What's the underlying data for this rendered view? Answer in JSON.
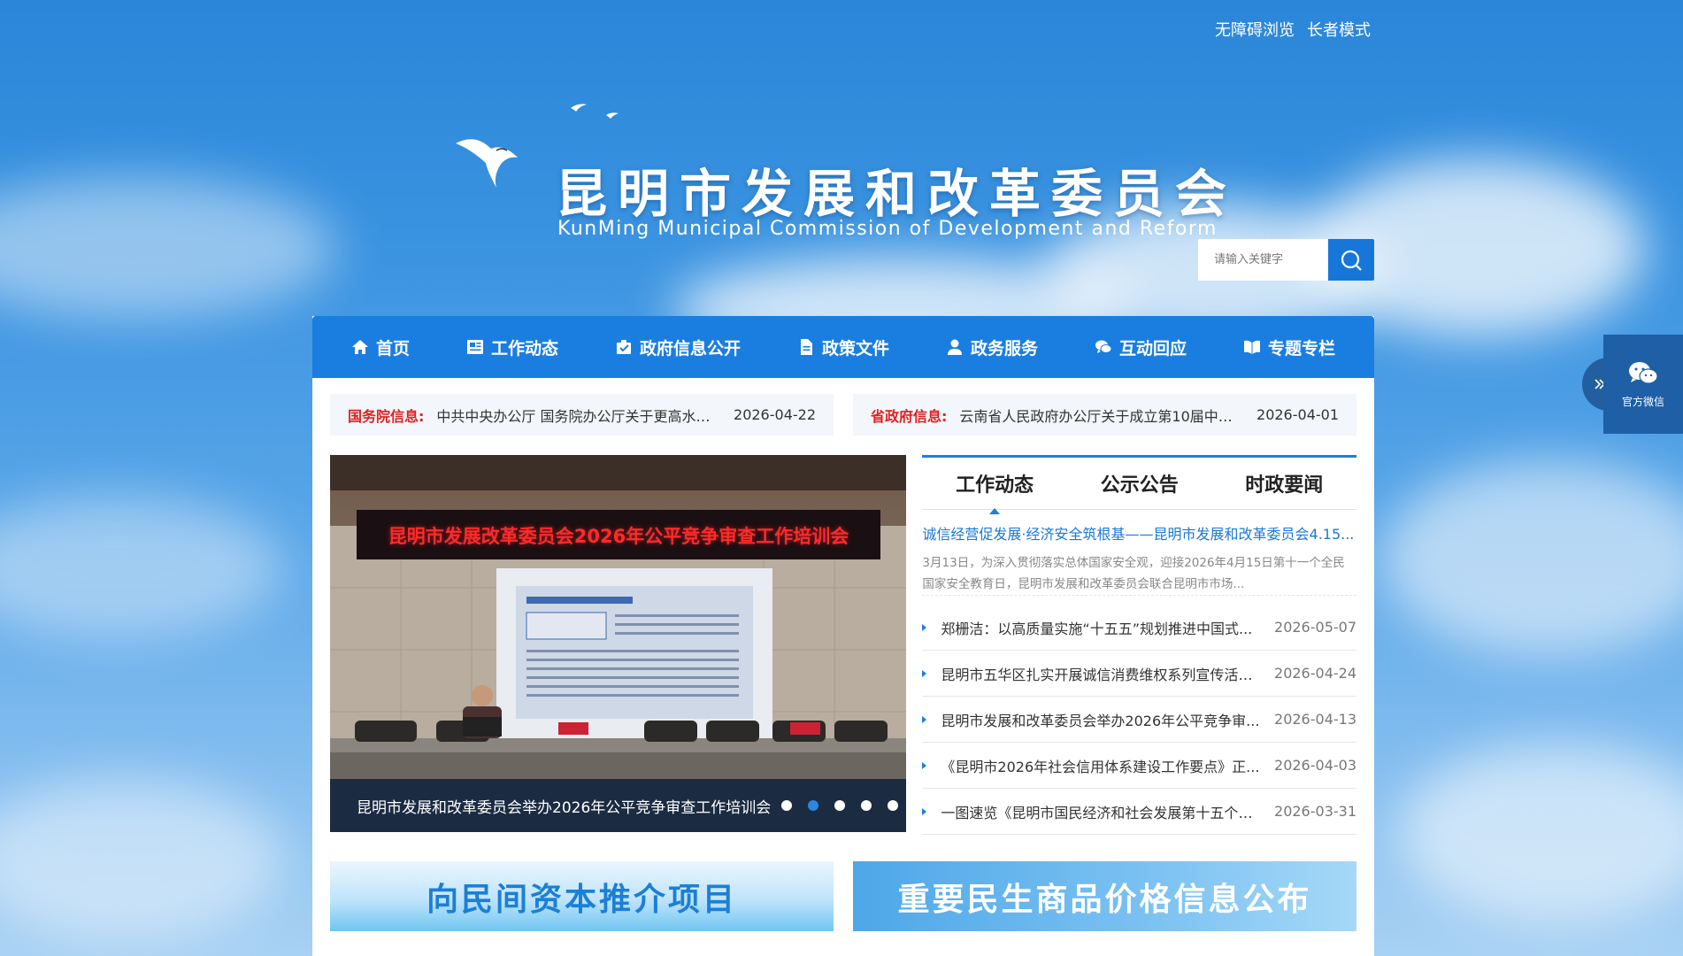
{
  "topbar": {
    "accessible": "无障碍浏览",
    "elder_mode": "长者模式"
  },
  "header": {
    "title": "昆明市发展和改革委员会",
    "subtitle": "KunMing Municipal Commission of Development and Reform"
  },
  "search": {
    "placeholder": "请输入关键字"
  },
  "nav": [
    {
      "label": "首页",
      "icon": "home-icon"
    },
    {
      "label": "工作动态",
      "icon": "news-icon"
    },
    {
      "label": "政府信息公开",
      "icon": "clipboard-icon"
    },
    {
      "label": "政策文件",
      "icon": "document-icon"
    },
    {
      "label": "政务服务",
      "icon": "user-icon"
    },
    {
      "label": "互动回应",
      "icon": "chat-icon"
    },
    {
      "label": "专题专栏",
      "icon": "book-icon"
    }
  ],
  "tickers": [
    {
      "label": "国务院信息:",
      "text": "中共中央办公厅 国务院办公厅关于更高水平...",
      "date": "2026-04-22"
    },
    {
      "label": "省政府信息:",
      "text": "云南省人民政府办公厅关于成立第10届中国...",
      "date": "2026-04-01"
    }
  ],
  "slider": {
    "banner_text": "昆明市发展改革委员会2026年公平竞争审查工作培训会",
    "caption": "昆明市发展和改革委员会举办2026年公平竞争审查工作培训会",
    "active_index": 1,
    "slide_count": 5
  },
  "news": {
    "tabs": [
      "工作动态",
      "公示公告",
      "时政要闻"
    ],
    "active_tab": 0,
    "headline": "诚信经营促发展·经济安全筑根基——昆明市发展和改革委员会4.15...",
    "summary": "3月13日，为深入贯彻落实总体国家安全观，迎接2026年4月15日第十一个全民国家安全教育日，昆明市发展和改革委员会联合昆明市市场...",
    "items": [
      {
        "title": "郑栅洁：以高质量实施“十五五”规划推进中国式...",
        "date": "2026-05-07"
      },
      {
        "title": "昆明市五华区扎实开展诚信消费维权系列宣传活动 ...",
        "date": "2026-04-24"
      },
      {
        "title": "昆明市发展和改革委员会举办2026年公平竞争审...",
        "date": "2026-04-13"
      },
      {
        "title": "《昆明市2026年社会信用体系建设工作要点》正...",
        "date": "2026-04-03"
      },
      {
        "title": "一图速览《昆明市国民经济和社会发展第十五个五...",
        "date": "2026-03-31"
      }
    ]
  },
  "banners": [
    {
      "label": "向民间资本推介项目"
    },
    {
      "label": "重要民生商品价格信息公布"
    }
  ],
  "side_widget": {
    "label": "官方微信"
  },
  "colors": {
    "primary": "#1a7ee0",
    "accent_red": "#e02020",
    "link_blue": "#1a78d4"
  }
}
